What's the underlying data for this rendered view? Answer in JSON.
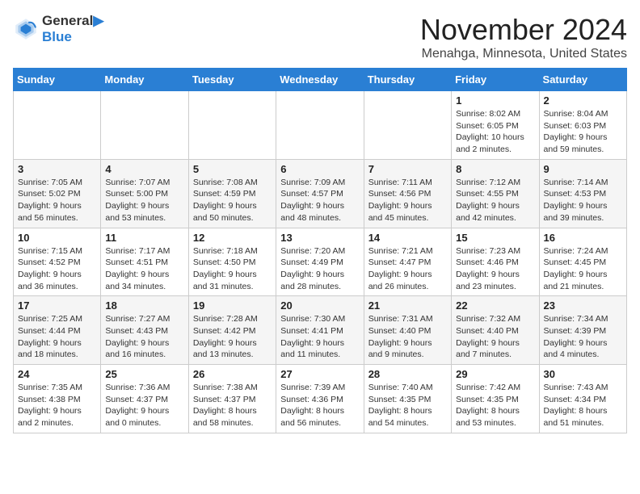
{
  "header": {
    "logo_line1": "General",
    "logo_line2": "Blue",
    "month": "November 2024",
    "location": "Menahga, Minnesota, United States"
  },
  "weekdays": [
    "Sunday",
    "Monday",
    "Tuesday",
    "Wednesday",
    "Thursday",
    "Friday",
    "Saturday"
  ],
  "weeks": [
    [
      {
        "day": "",
        "info": ""
      },
      {
        "day": "",
        "info": ""
      },
      {
        "day": "",
        "info": ""
      },
      {
        "day": "",
        "info": ""
      },
      {
        "day": "",
        "info": ""
      },
      {
        "day": "1",
        "info": "Sunrise: 8:02 AM\nSunset: 6:05 PM\nDaylight: 10 hours\nand 2 minutes."
      },
      {
        "day": "2",
        "info": "Sunrise: 8:04 AM\nSunset: 6:03 PM\nDaylight: 9 hours\nand 59 minutes."
      }
    ],
    [
      {
        "day": "3",
        "info": "Sunrise: 7:05 AM\nSunset: 5:02 PM\nDaylight: 9 hours\nand 56 minutes."
      },
      {
        "day": "4",
        "info": "Sunrise: 7:07 AM\nSunset: 5:00 PM\nDaylight: 9 hours\nand 53 minutes."
      },
      {
        "day": "5",
        "info": "Sunrise: 7:08 AM\nSunset: 4:59 PM\nDaylight: 9 hours\nand 50 minutes."
      },
      {
        "day": "6",
        "info": "Sunrise: 7:09 AM\nSunset: 4:57 PM\nDaylight: 9 hours\nand 48 minutes."
      },
      {
        "day": "7",
        "info": "Sunrise: 7:11 AM\nSunset: 4:56 PM\nDaylight: 9 hours\nand 45 minutes."
      },
      {
        "day": "8",
        "info": "Sunrise: 7:12 AM\nSunset: 4:55 PM\nDaylight: 9 hours\nand 42 minutes."
      },
      {
        "day": "9",
        "info": "Sunrise: 7:14 AM\nSunset: 4:53 PM\nDaylight: 9 hours\nand 39 minutes."
      }
    ],
    [
      {
        "day": "10",
        "info": "Sunrise: 7:15 AM\nSunset: 4:52 PM\nDaylight: 9 hours\nand 36 minutes."
      },
      {
        "day": "11",
        "info": "Sunrise: 7:17 AM\nSunset: 4:51 PM\nDaylight: 9 hours\nand 34 minutes."
      },
      {
        "day": "12",
        "info": "Sunrise: 7:18 AM\nSunset: 4:50 PM\nDaylight: 9 hours\nand 31 minutes."
      },
      {
        "day": "13",
        "info": "Sunrise: 7:20 AM\nSunset: 4:49 PM\nDaylight: 9 hours\nand 28 minutes."
      },
      {
        "day": "14",
        "info": "Sunrise: 7:21 AM\nSunset: 4:47 PM\nDaylight: 9 hours\nand 26 minutes."
      },
      {
        "day": "15",
        "info": "Sunrise: 7:23 AM\nSunset: 4:46 PM\nDaylight: 9 hours\nand 23 minutes."
      },
      {
        "day": "16",
        "info": "Sunrise: 7:24 AM\nSunset: 4:45 PM\nDaylight: 9 hours\nand 21 minutes."
      }
    ],
    [
      {
        "day": "17",
        "info": "Sunrise: 7:25 AM\nSunset: 4:44 PM\nDaylight: 9 hours\nand 18 minutes."
      },
      {
        "day": "18",
        "info": "Sunrise: 7:27 AM\nSunset: 4:43 PM\nDaylight: 9 hours\nand 16 minutes."
      },
      {
        "day": "19",
        "info": "Sunrise: 7:28 AM\nSunset: 4:42 PM\nDaylight: 9 hours\nand 13 minutes."
      },
      {
        "day": "20",
        "info": "Sunrise: 7:30 AM\nSunset: 4:41 PM\nDaylight: 9 hours\nand 11 minutes."
      },
      {
        "day": "21",
        "info": "Sunrise: 7:31 AM\nSunset: 4:40 PM\nDaylight: 9 hours\nand 9 minutes."
      },
      {
        "day": "22",
        "info": "Sunrise: 7:32 AM\nSunset: 4:40 PM\nDaylight: 9 hours\nand 7 minutes."
      },
      {
        "day": "23",
        "info": "Sunrise: 7:34 AM\nSunset: 4:39 PM\nDaylight: 9 hours\nand 4 minutes."
      }
    ],
    [
      {
        "day": "24",
        "info": "Sunrise: 7:35 AM\nSunset: 4:38 PM\nDaylight: 9 hours\nand 2 minutes."
      },
      {
        "day": "25",
        "info": "Sunrise: 7:36 AM\nSunset: 4:37 PM\nDaylight: 9 hours\nand 0 minutes."
      },
      {
        "day": "26",
        "info": "Sunrise: 7:38 AM\nSunset: 4:37 PM\nDaylight: 8 hours\nand 58 minutes."
      },
      {
        "day": "27",
        "info": "Sunrise: 7:39 AM\nSunset: 4:36 PM\nDaylight: 8 hours\nand 56 minutes."
      },
      {
        "day": "28",
        "info": "Sunrise: 7:40 AM\nSunset: 4:35 PM\nDaylight: 8 hours\nand 54 minutes."
      },
      {
        "day": "29",
        "info": "Sunrise: 7:42 AM\nSunset: 4:35 PM\nDaylight: 8 hours\nand 53 minutes."
      },
      {
        "day": "30",
        "info": "Sunrise: 7:43 AM\nSunset: 4:34 PM\nDaylight: 8 hours\nand 51 minutes."
      }
    ]
  ]
}
